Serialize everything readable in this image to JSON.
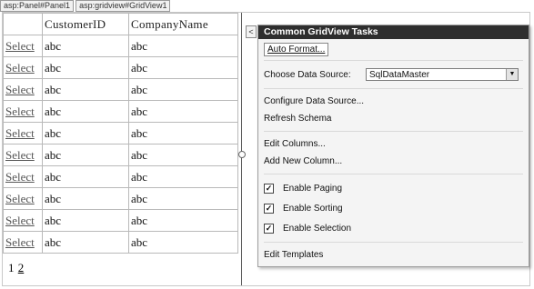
{
  "tabs": [
    "asp:Panel#Panel1",
    "asp:gridview#GridView1"
  ],
  "grid": {
    "headers": [
      "",
      "CustomerID",
      "CompanyName"
    ],
    "rows": [
      [
        "Select",
        "abc",
        "abc"
      ],
      [
        "Select",
        "abc",
        "abc"
      ],
      [
        "Select",
        "abc",
        "abc"
      ],
      [
        "Select",
        "abc",
        "abc"
      ],
      [
        "Select",
        "abc",
        "abc"
      ],
      [
        "Select",
        "abc",
        "abc"
      ],
      [
        "Select",
        "abc",
        "abc"
      ],
      [
        "Select",
        "abc",
        "abc"
      ],
      [
        "Select",
        "abc",
        "abc"
      ],
      [
        "Select",
        "abc",
        "abc"
      ]
    ],
    "pager": [
      "1",
      "2"
    ]
  },
  "tasks": {
    "arrow": "<",
    "title": "Common GridView Tasks",
    "auto_format": "Auto Format...",
    "choose_ds_label": "Choose Data Source:",
    "ds_value": "SqlDataMaster",
    "configure": "Configure Data Source...",
    "refresh": "Refresh Schema",
    "edit_columns": "Edit Columns...",
    "add_column": "Add New Column...",
    "checks": [
      {
        "label": "Enable Paging",
        "checked": true
      },
      {
        "label": "Enable Sorting",
        "checked": true
      },
      {
        "label": "Enable Selection",
        "checked": true
      }
    ],
    "edit_templates": "Edit Templates"
  }
}
